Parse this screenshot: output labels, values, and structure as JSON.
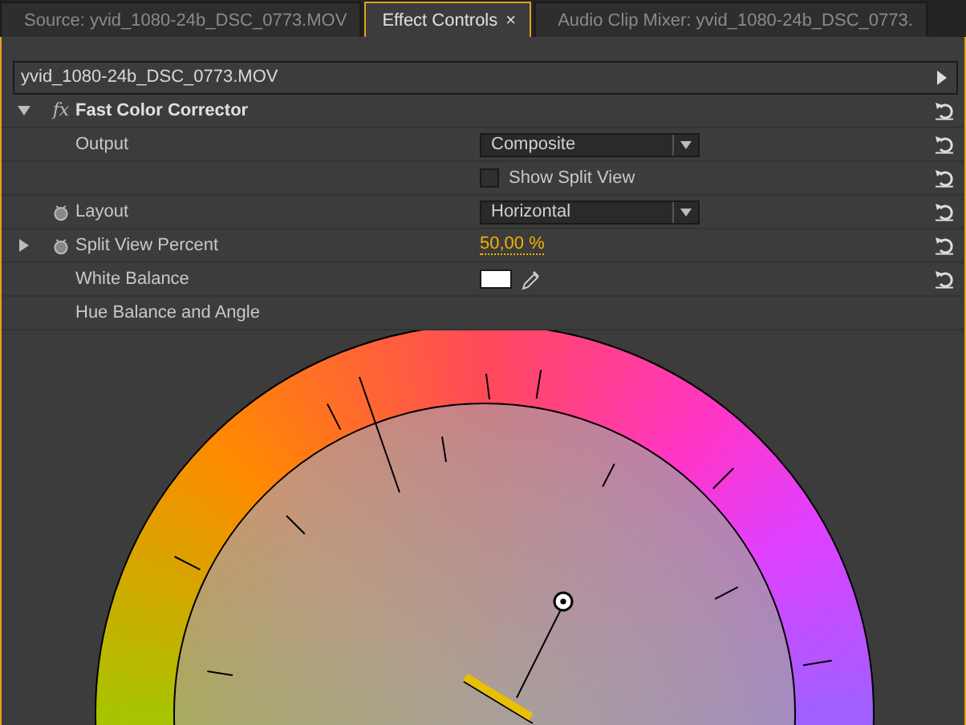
{
  "tabs": [
    {
      "label": "Source: yvid_1080-24b_DSC_0773.MOV",
      "selected": false
    },
    {
      "label": "Effect Controls",
      "selected": true,
      "close_glyph": "×"
    },
    {
      "label": "Audio Clip Mixer: yvid_1080-24b_DSC_0773.",
      "selected": false
    }
  ],
  "clip_header": {
    "title": "yvid_1080-24b_DSC_0773.MOV"
  },
  "effect": {
    "badge": "fx",
    "name": "Fast Color Corrector",
    "expanded": true,
    "resettable": true
  },
  "properties": [
    {
      "kind": "dropdown",
      "label": "Output",
      "value": "Composite",
      "stopwatch": false,
      "expandable": false,
      "resettable": true
    },
    {
      "kind": "checkbox",
      "label": "Show Split View",
      "checked": false,
      "stopwatch": false,
      "expandable": false,
      "resettable": true
    },
    {
      "kind": "dropdown",
      "label": "Layout",
      "value": "Horizontal",
      "stopwatch": true,
      "expandable": false,
      "resettable": true
    },
    {
      "kind": "value",
      "label": "Split View Percent",
      "value": "50,00 %",
      "stopwatch": true,
      "expandable": true,
      "resettable": true
    },
    {
      "kind": "color",
      "label": "White Balance",
      "color": "#ffffff",
      "stopwatch": false,
      "expandable": false,
      "resettable": true
    },
    {
      "kind": "heading",
      "label": "Hue Balance and Angle",
      "stopwatch": false,
      "expandable": false,
      "resettable": false
    }
  ]
}
